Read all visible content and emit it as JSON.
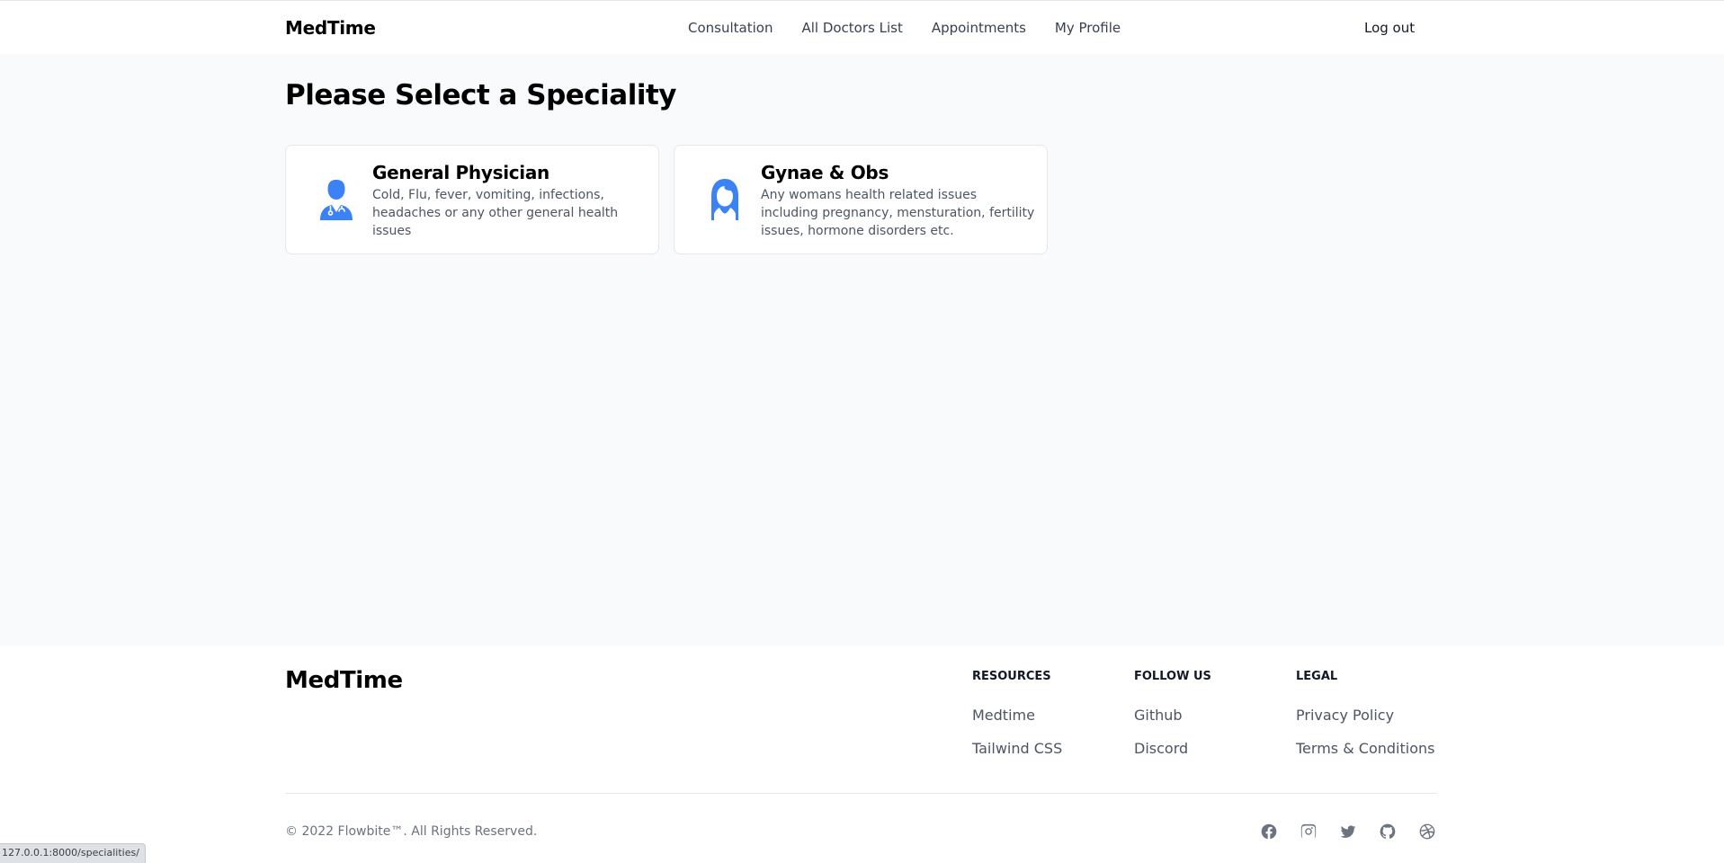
{
  "navbar": {
    "brand": "MedTime",
    "links": [
      {
        "label": "Consultation"
      },
      {
        "label": "All Doctors List"
      },
      {
        "label": "Appointments"
      },
      {
        "label": "My Profile"
      }
    ],
    "logout_label": "Log out"
  },
  "main": {
    "title": "Please Select a Speciality",
    "specialities": [
      {
        "icon": "doctor-icon",
        "title": "General Physician",
        "description": "Cold, Flu, fever, vomiting, infections, headaches or any other general health issues"
      },
      {
        "icon": "woman-icon",
        "title": "Gynae & Obs",
        "description": "Any womans health related issues including pregnancy, mensturation, fertility issues, hormone disorders etc."
      }
    ]
  },
  "footer": {
    "brand": "MedTime",
    "columns": [
      {
        "heading": "RESOURCES",
        "links": [
          "Medtime",
          "Tailwind CSS"
        ]
      },
      {
        "heading": "FOLLOW US",
        "links": [
          "Github",
          "Discord"
        ]
      },
      {
        "heading": "LEGAL",
        "links": [
          "Privacy Policy",
          "Terms & Conditions"
        ]
      }
    ],
    "copyright": "© 2022 Flowbite™. All Rights Reserved.",
    "social_icons": [
      "facebook-icon",
      "instagram-icon",
      "twitter-icon",
      "github-icon",
      "dribbble-icon"
    ]
  },
  "status_bar": {
    "url": "127.0.0.1:8000/specialities/"
  },
  "colors": {
    "accent": "#3b82f6",
    "background": "#f9fafb",
    "card_border": "#e5e7eb",
    "text_muted": "#4b5563"
  }
}
